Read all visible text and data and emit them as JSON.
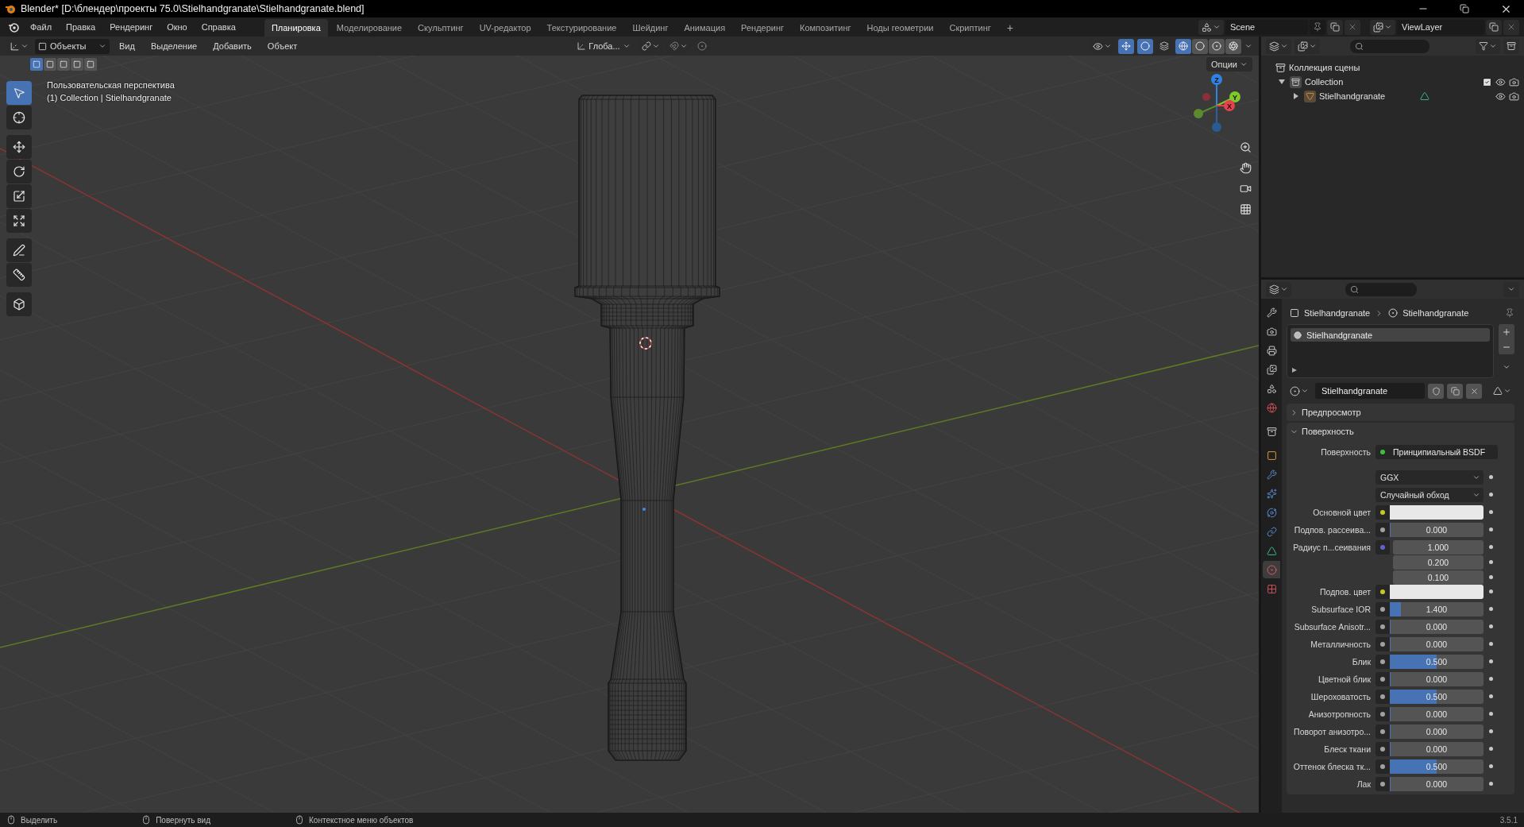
{
  "window": {
    "title": "Blender* [D:\\блендер\\проекты 75.0\\Stielhandgranate\\Stielhandgranate.blend]"
  },
  "menu": [
    "Файл",
    "Правка",
    "Рендеринг",
    "Окно",
    "Справка"
  ],
  "workspaces": [
    {
      "label": "Планировка",
      "selected": true
    },
    {
      "label": "Моделирование",
      "selected": false
    },
    {
      "label": "Скульптинг",
      "selected": false
    },
    {
      "label": "UV-редактор",
      "selected": false
    },
    {
      "label": "Текстурирование",
      "selected": false
    },
    {
      "label": "Шейдинг",
      "selected": false
    },
    {
      "label": "Анимация",
      "selected": false
    },
    {
      "label": "Рендеринг",
      "selected": false
    },
    {
      "label": "Композитинг",
      "selected": false
    },
    {
      "label": "Ноды геометрии",
      "selected": false
    },
    {
      "label": "Скриптинг",
      "selected": false
    }
  ],
  "add_workspace": "+",
  "scene": {
    "name": "Scene"
  },
  "view_layer": {
    "name": "ViewLayer"
  },
  "viewport": {
    "mode": "Объекты",
    "menus": [
      "Вид",
      "Выделение",
      "Добавить",
      "Объект"
    ],
    "orientation": "Глоба...",
    "options": "Опции",
    "select_modes": [
      {
        "selected": true
      },
      {
        "selected": false
      },
      {
        "selected": false
      },
      {
        "selected": false
      },
      {
        "selected": false
      }
    ],
    "shading": [
      {
        "kind": "wireframe",
        "selected": true
      },
      {
        "kind": "solid",
        "selected": false
      },
      {
        "kind": "material",
        "selected": false
      },
      {
        "kind": "rendered",
        "selected": false
      }
    ],
    "overlay_lines": [
      "Пользовательская перспектива",
      "(1) Collection | Stielhandgranate"
    ],
    "tools": [
      {
        "kind": "select",
        "selected": true
      },
      {
        "kind": "cursor",
        "selected": false
      },
      {
        "kind": "move",
        "selected": false
      },
      {
        "kind": "rotate",
        "selected": false
      },
      {
        "kind": "scale",
        "selected": false
      },
      {
        "kind": "transform",
        "selected": false
      },
      {
        "kind": "annotate",
        "selected": false
      },
      {
        "kind": "measure",
        "selected": false
      },
      {
        "kind": "add_cube",
        "selected": false
      }
    ],
    "gizmo": [
      {
        "label": "Z",
        "color": "#2f83e6"
      },
      {
        "label": "Y",
        "color": "#7fc92a"
      },
      {
        "label": "X",
        "color": "#e8404e"
      }
    ]
  },
  "outliner": {
    "root": "Коллекция сцены",
    "tree": [
      {
        "name": "Collection",
        "kind": "collection",
        "expanded": true,
        "checked": true,
        "children": [
          {
            "name": "Stielhandgranate",
            "kind": "object",
            "expanded": false
          }
        ]
      }
    ]
  },
  "properties": {
    "tabs": [
      {
        "kind": "tool",
        "selected": false
      },
      {
        "kind": "render",
        "selected": false
      },
      {
        "kind": "output",
        "selected": false
      },
      {
        "kind": "view_layer",
        "selected": false
      },
      {
        "kind": "scene",
        "selected": false
      },
      {
        "kind": "world",
        "selected": false
      },
      {
        "kind": "collection",
        "selected": false
      },
      {
        "kind": "object",
        "selected": false
      },
      {
        "kind": "modifiers",
        "selected": false
      },
      {
        "kind": "particles",
        "selected": false
      },
      {
        "kind": "physics",
        "selected": false
      },
      {
        "kind": "constraints",
        "selected": false
      },
      {
        "kind": "data",
        "selected": false
      },
      {
        "kind": "material",
        "selected": true
      },
      {
        "kind": "texture",
        "selected": false
      }
    ],
    "breadcrumb": [
      "Stielhandgranate",
      "Stielhandgranate"
    ],
    "slots": [
      {
        "name": "Stielhandgranate",
        "selected": true
      }
    ],
    "material": "Stielhandgranate",
    "panels": [
      {
        "title": "Предпросмотр",
        "expanded": false
      },
      {
        "title": "Поверхность",
        "expanded": true
      }
    ],
    "rows": [
      {
        "kind": "shader",
        "label": "Поверхность",
        "value": "Принципиальный BSDF",
        "color": "#3fbf3f"
      },
      {
        "kind": "enum",
        "value": "GGX"
      },
      {
        "kind": "enum",
        "value": "Случайный обход"
      },
      {
        "kind": "color",
        "label": "Основной цвет",
        "color": "#c7c729"
      },
      {
        "kind": "number",
        "label": "Подпов. рассеива...",
        "value": "0.000",
        "level": 0,
        "color": "#a1a1a1"
      },
      {
        "kind": "vector",
        "label": "Радиус п...сеивания",
        "values": [
          "1.000",
          "0.200",
          "0.100"
        ],
        "color": "#6363c7"
      },
      {
        "kind": "color",
        "label": "Подпов. цвет",
        "color": "#c7c729"
      },
      {
        "kind": "number",
        "label": "Subsurface IOR",
        "value": "1.400",
        "level": 0.12,
        "color": "#a1a1a1"
      },
      {
        "kind": "number",
        "label": "Subsurface Anisotr...",
        "value": "0.000",
        "level": 0,
        "color": "#a1a1a1"
      },
      {
        "kind": "number",
        "label": "Металличность",
        "value": "0.000",
        "level": 0,
        "color": "#a1a1a1"
      },
      {
        "kind": "number",
        "label": "Блик",
        "value": "0.500",
        "level": 0.5,
        "color": "#a1a1a1"
      },
      {
        "kind": "number",
        "label": "Цветной блик",
        "value": "0.000",
        "level": 0,
        "color": "#a1a1a1"
      },
      {
        "kind": "number",
        "label": "Шероховатость",
        "value": "0.500",
        "level": 0.5,
        "color": "#a1a1a1"
      },
      {
        "kind": "number",
        "label": "Анизотропность",
        "value": "0.000",
        "level": 0,
        "color": "#a1a1a1"
      },
      {
        "kind": "number",
        "label": "Поворот анизотро...",
        "value": "0.000",
        "level": 0,
        "color": "#a1a1a1"
      },
      {
        "kind": "number",
        "label": "Блеск ткани",
        "value": "0.000",
        "level": 0,
        "color": "#a1a1a1"
      },
      {
        "kind": "number",
        "label": "Оттенок блеска тк...",
        "value": "0.500",
        "level": 0.5,
        "color": "#a1a1a1"
      },
      {
        "kind": "number",
        "label": "Лак",
        "value": "0.000",
        "level": 0,
        "color": "#a1a1a1"
      }
    ]
  },
  "status_bar": {
    "hints": [
      "Выделить",
      "Повернуть вид",
      "Контекстное меню объектов"
    ],
    "version": "3.5.1"
  }
}
